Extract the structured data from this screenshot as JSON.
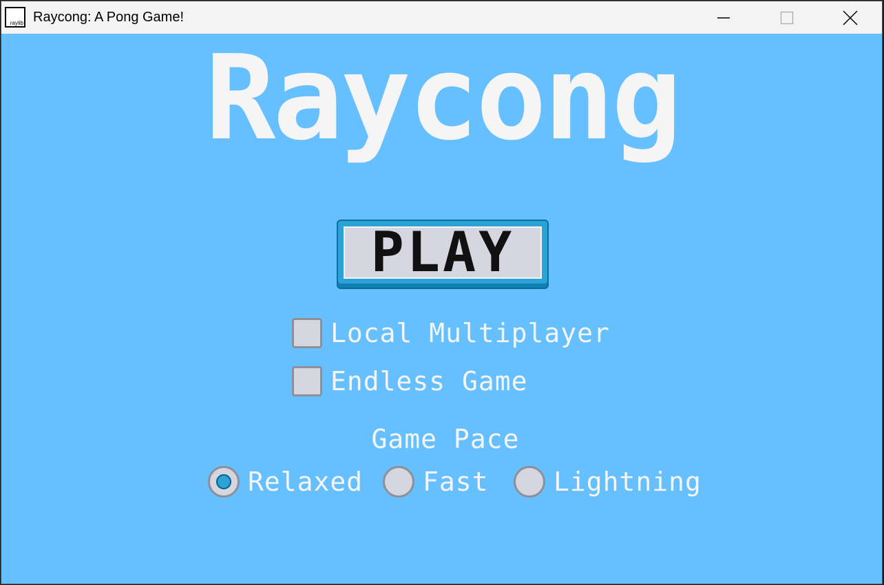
{
  "window": {
    "title": "Raycong: A Pong Game!",
    "icon_label": "raylib",
    "controls": [
      "minimize-icon",
      "maximize-icon",
      "close-icon"
    ]
  },
  "game": {
    "title": "Raycong",
    "play_label": "PLAY",
    "options": [
      {
        "label": "Local Multiplayer",
        "checked": false
      },
      {
        "label": "Endless Game",
        "checked": false
      }
    ],
    "pace": {
      "title": "Game Pace",
      "choices": [
        "Relaxed",
        "Fast",
        "Lightning"
      ],
      "selected": "Relaxed"
    }
  },
  "colors": {
    "background": "#66bfff",
    "button_accent": "#2aa4d8",
    "control_fill": "#d6d6e0",
    "text": "#f5f5f5"
  }
}
